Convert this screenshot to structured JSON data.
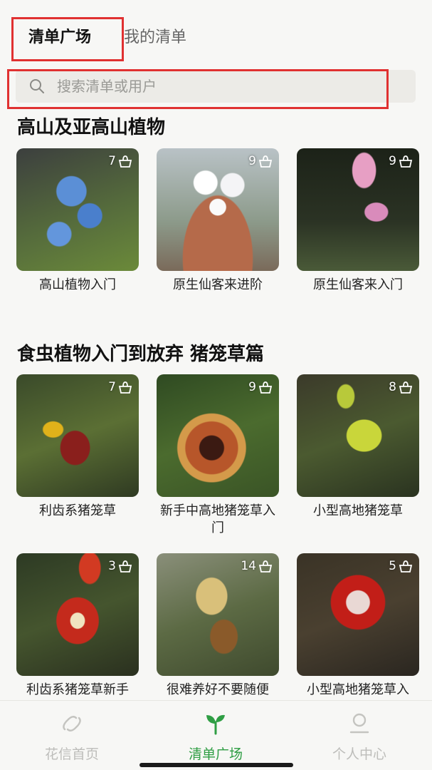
{
  "header": {
    "tabs": [
      {
        "label": "清单广场",
        "active": true
      },
      {
        "label": "我的清单",
        "active": false
      }
    ]
  },
  "search": {
    "placeholder": "搜索清单或用户"
  },
  "sections": [
    {
      "title": "高山及亚高山植物",
      "cards": [
        {
          "label": "高山植物入门",
          "count": "7"
        },
        {
          "label": "原生仙客来进阶",
          "count": "9"
        },
        {
          "label": "原生仙客来入门",
          "count": "9"
        }
      ]
    },
    {
      "title": "食虫植物入门到放弃 猪笼草篇",
      "cards": [
        {
          "label": "利齿系猪笼草",
          "count": "7"
        },
        {
          "label": "新手中高地猪笼草入门",
          "count": "9"
        },
        {
          "label": "小型高地猪笼草",
          "count": "8"
        },
        {
          "label": "利齿系猪笼草新手",
          "count": "3"
        },
        {
          "label": "很难养好不要随便",
          "count": "14"
        },
        {
          "label": "小型高地猪笼草入",
          "count": "5"
        }
      ]
    }
  ],
  "bottom_nav": [
    {
      "label": "花信首页",
      "icon": "link-icon",
      "active": false
    },
    {
      "label": "清单广场",
      "icon": "sprout-icon",
      "active": true
    },
    {
      "label": "个人中心",
      "icon": "person-icon",
      "active": false
    }
  ],
  "colors": {
    "accent": "#2f9e44",
    "highlight": "#e03131"
  }
}
